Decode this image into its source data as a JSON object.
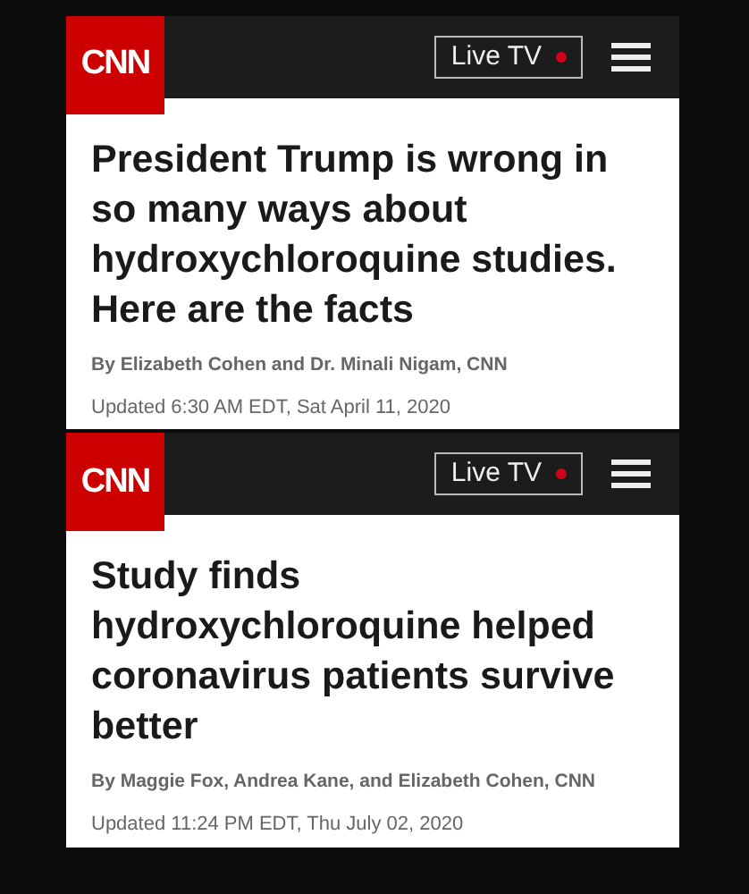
{
  "articles": [
    {
      "logo": "CNN",
      "live_tv": "Live TV",
      "headline": "President Trump is wrong in so many ways about hydroxychloroquine studies. Here are the facts",
      "byline": "By Elizabeth Cohen and Dr. Minali Nigam, CNN",
      "updated": "Updated 6:30 AM EDT, Sat April 11, 2020"
    },
    {
      "logo": "CNN",
      "live_tv": "Live TV",
      "headline": "Study finds hydroxychloroquine helped coronavirus patients survive better",
      "byline": "By Maggie Fox, Andrea Kane, and Elizabeth Cohen, CNN",
      "updated": "Updated 11:24 PM EDT, Thu July 02, 2020"
    }
  ]
}
